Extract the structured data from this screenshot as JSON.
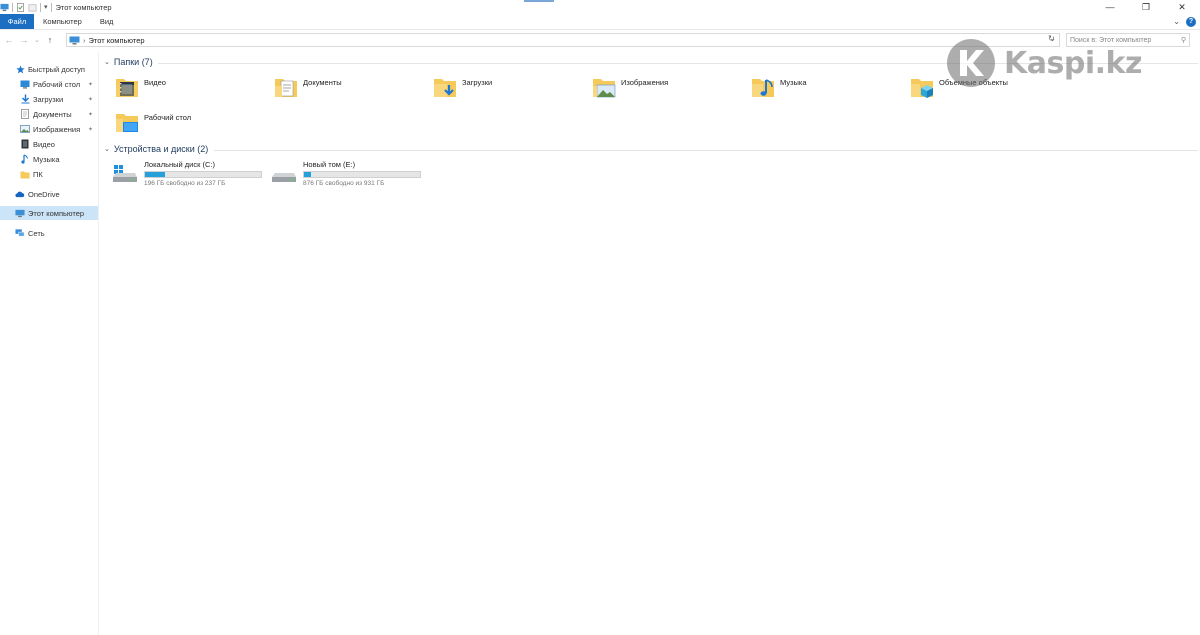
{
  "window": {
    "title": "Этот компьютер",
    "controls": {
      "minimize": "—",
      "restore": "❐",
      "close": "✕"
    }
  },
  "ribbon": {
    "tabs": [
      {
        "label": "Файл",
        "active": true
      },
      {
        "label": "Компьютер"
      },
      {
        "label": "Вид"
      }
    ],
    "expand": "⌄",
    "help": "?"
  },
  "address": {
    "back": "←",
    "forward": "→",
    "recent": "⌄",
    "up": "↑",
    "path_separator": "›",
    "path": "Этот компьютер",
    "dropdown": "⌄",
    "refresh": "↻",
    "search_placeholder": "Поиск в: Этот компьютер",
    "search_icon": "⚲"
  },
  "sidebar": {
    "items": [
      {
        "label": "Быстрый доступ",
        "icon": "star-icon",
        "level": 0
      },
      {
        "label": "Рабочий стол",
        "icon": "desktop-icon",
        "level": 1,
        "pinned": true
      },
      {
        "label": "Загрузки",
        "icon": "download-icon",
        "level": 1,
        "pinned": true
      },
      {
        "label": "Документы",
        "icon": "document-icon",
        "level": 1,
        "pinned": true
      },
      {
        "label": "Изображения",
        "icon": "pictures-icon",
        "level": 1,
        "pinned": true
      },
      {
        "label": "Видео",
        "icon": "video-icon",
        "level": 1
      },
      {
        "label": "Музыка",
        "icon": "music-icon",
        "level": 1
      },
      {
        "label": "ПК",
        "icon": "folder-icon",
        "level": 1
      },
      {
        "label": "OneDrive",
        "icon": "cloud-icon",
        "level": 0
      },
      {
        "label": "Этот компьютер",
        "icon": "computer-icon",
        "level": 0,
        "selected": true
      },
      {
        "label": "Сеть",
        "icon": "network-icon",
        "level": 0
      }
    ],
    "pin_glyph": "📌"
  },
  "folders_section": {
    "title": "Папки (7)",
    "caret": "⌄",
    "items": [
      {
        "label": "Видео",
        "icon": "video-folder-icon"
      },
      {
        "label": "Документы",
        "icon": "documents-folder-icon"
      },
      {
        "label": "Загрузки",
        "icon": "downloads-folder-icon"
      },
      {
        "label": "Изображения",
        "icon": "pictures-folder-icon"
      },
      {
        "label": "Музыка",
        "icon": "music-folder-icon"
      },
      {
        "label": "Объемные объекты",
        "icon": "3d-objects-folder-icon"
      },
      {
        "label": "Рабочий стол",
        "icon": "desktop-folder-icon"
      }
    ]
  },
  "drives_section": {
    "title": "Устройства и диски (2)",
    "caret": "⌄",
    "items": [
      {
        "label": "Локальный диск (C:)",
        "free": "196 ГБ свободно из 237 ГБ",
        "used_fraction": 0.173,
        "icon": "windows-drive-icon"
      },
      {
        "label": "Новый том (E:)",
        "free": "876 ГБ свободно из 931 ГБ",
        "used_fraction": 0.059,
        "icon": "drive-icon"
      }
    ]
  },
  "watermark": {
    "text": "Kaspi.kz"
  },
  "colors": {
    "accent": "#1b6ec2",
    "selection": "#cce4f7",
    "drive_bar": "#26a0da",
    "folder": "#f5c95a"
  }
}
